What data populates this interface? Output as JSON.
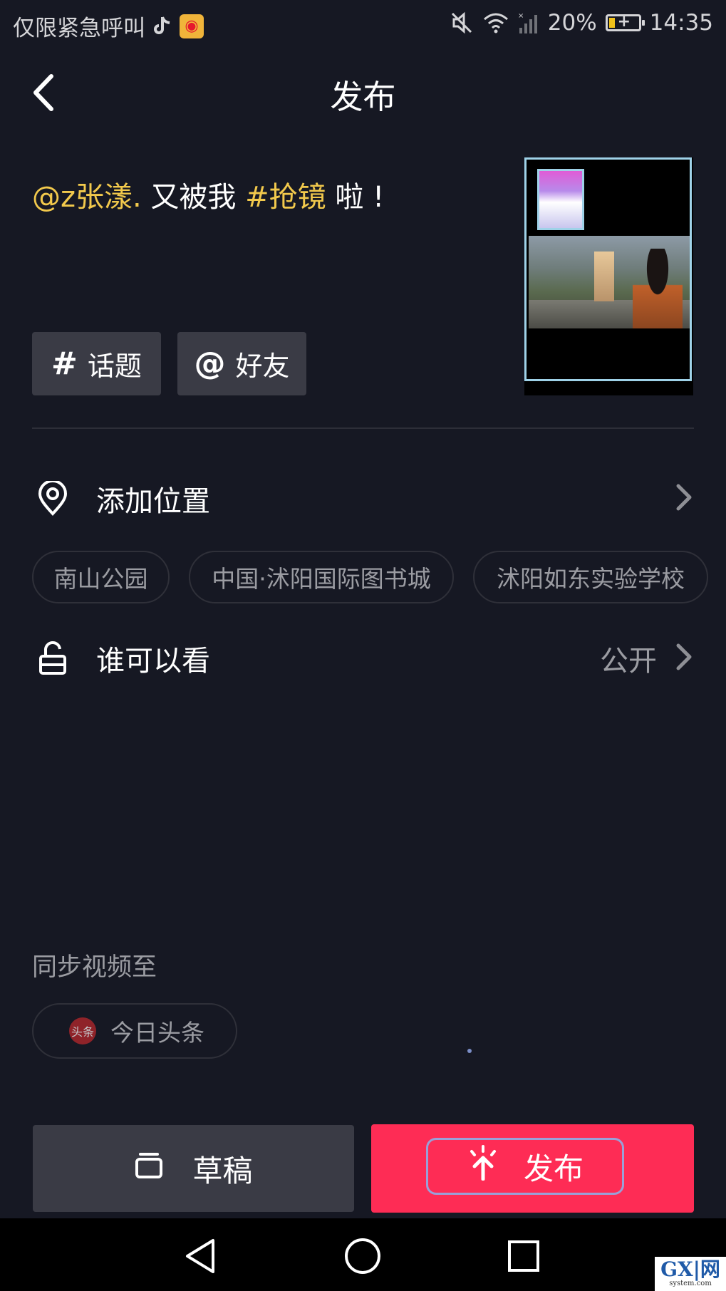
{
  "status_bar": {
    "carrier": "仅限紧急呼叫",
    "battery": "20%",
    "battery_level": 0.2,
    "time": "14:35"
  },
  "header": {
    "title": "发布"
  },
  "caption": {
    "mention": "@z张漾.",
    "text1": " 又被我 ",
    "hashtag": "#抢镜",
    "text2": " 啦 !"
  },
  "tags": {
    "topic_symbol": "#",
    "topic_label": "话题",
    "friend_symbol": "@",
    "friend_label": "好友"
  },
  "location": {
    "label": "添加位置",
    "suggestions": [
      "南山公园",
      "中国·沭阳国际图书城",
      "沭阳如东实验学校"
    ]
  },
  "privacy": {
    "label": "谁可以看",
    "value": "公开"
  },
  "sync": {
    "label": "同步视频至",
    "target": "今日头条",
    "logo_text": "头条"
  },
  "actions": {
    "draft_label": "草稿",
    "publish_label": "发布"
  },
  "watermark": {
    "main": "GX|网",
    "sub": "system.com"
  }
}
